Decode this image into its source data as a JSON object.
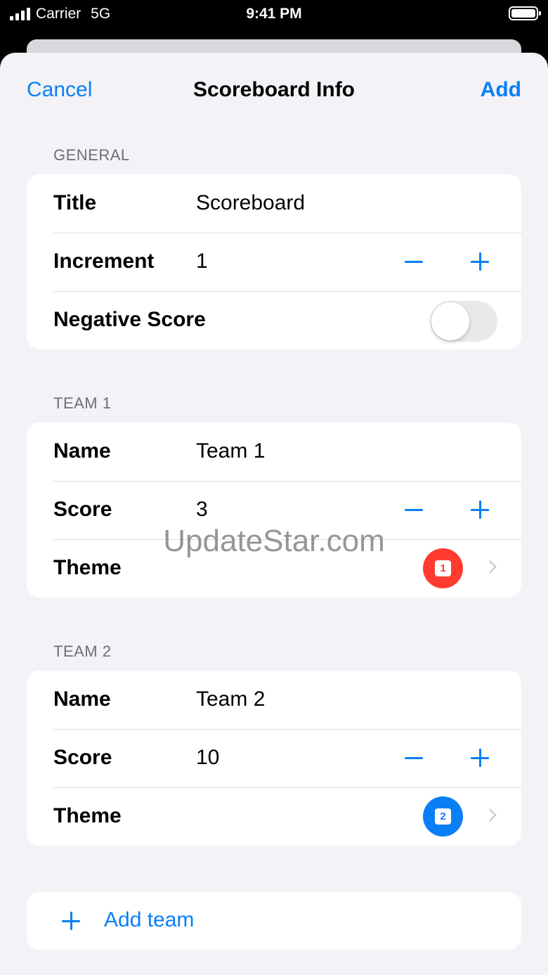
{
  "status_bar": {
    "carrier": "Carrier",
    "network": "5G",
    "time": "9:41 PM"
  },
  "nav": {
    "cancel_label": "Cancel",
    "title": "Scoreboard Info",
    "add_label": "Add"
  },
  "general": {
    "header": "GENERAL",
    "title_label": "Title",
    "title_value": "Scoreboard",
    "increment_label": "Increment",
    "increment_value": "1",
    "negative_score_label": "Negative Score",
    "negative_score_enabled": false
  },
  "teams": [
    {
      "header": "TEAM 1",
      "name_label": "Name",
      "name_value": "Team 1",
      "score_label": "Score",
      "score_value": "3",
      "theme_label": "Theme",
      "theme_badge": "1",
      "theme_color": "#ff3b30"
    },
    {
      "header": "TEAM 2",
      "name_label": "Name",
      "name_value": "Team 2",
      "score_label": "Score",
      "score_value": "10",
      "theme_label": "Theme",
      "theme_badge": "2",
      "theme_color": "#0a7ff5"
    }
  ],
  "add_team_label": "Add team",
  "watermark": "UpdateStar.com",
  "colors": {
    "accent": "#0a7ff5",
    "background": "#f2f2f7",
    "toggle_off": "#e9e9eb"
  }
}
